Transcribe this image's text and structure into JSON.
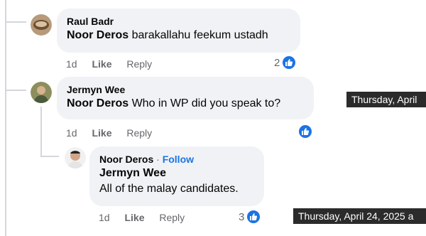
{
  "comments": [
    {
      "author": "Raul Badr",
      "reply_to": "Noor Deros",
      "text": "barakallahu feekum ustadh",
      "time": "1d",
      "like_label": "Like",
      "reply_label": "Reply",
      "reaction_count": "2"
    },
    {
      "author": "Jermyn Wee",
      "reply_to": "Noor Deros",
      "text": "Who in WP did you speak to?",
      "time": "1d",
      "like_label": "Like",
      "reply_label": "Reply",
      "reaction_count": ""
    }
  ],
  "reply": {
    "author": "Noor Deros",
    "separator": "·",
    "follow_label": "Follow",
    "reply_to": "Jermyn Wee",
    "text": "All of the malay candidates.",
    "time": "1d",
    "like_label": "Like",
    "reply_label": "Reply",
    "reaction_count": "3"
  },
  "tooltips": {
    "first": "Thursday, April",
    "second": "Thursday, April 24, 2025 a"
  },
  "colors": {
    "bubble": "#f0f2f5",
    "accent": "#1b74e4",
    "muted": "#65676b",
    "tooltip": "#2b2b2b"
  },
  "icons": {
    "like": "thumbs-up-icon"
  }
}
